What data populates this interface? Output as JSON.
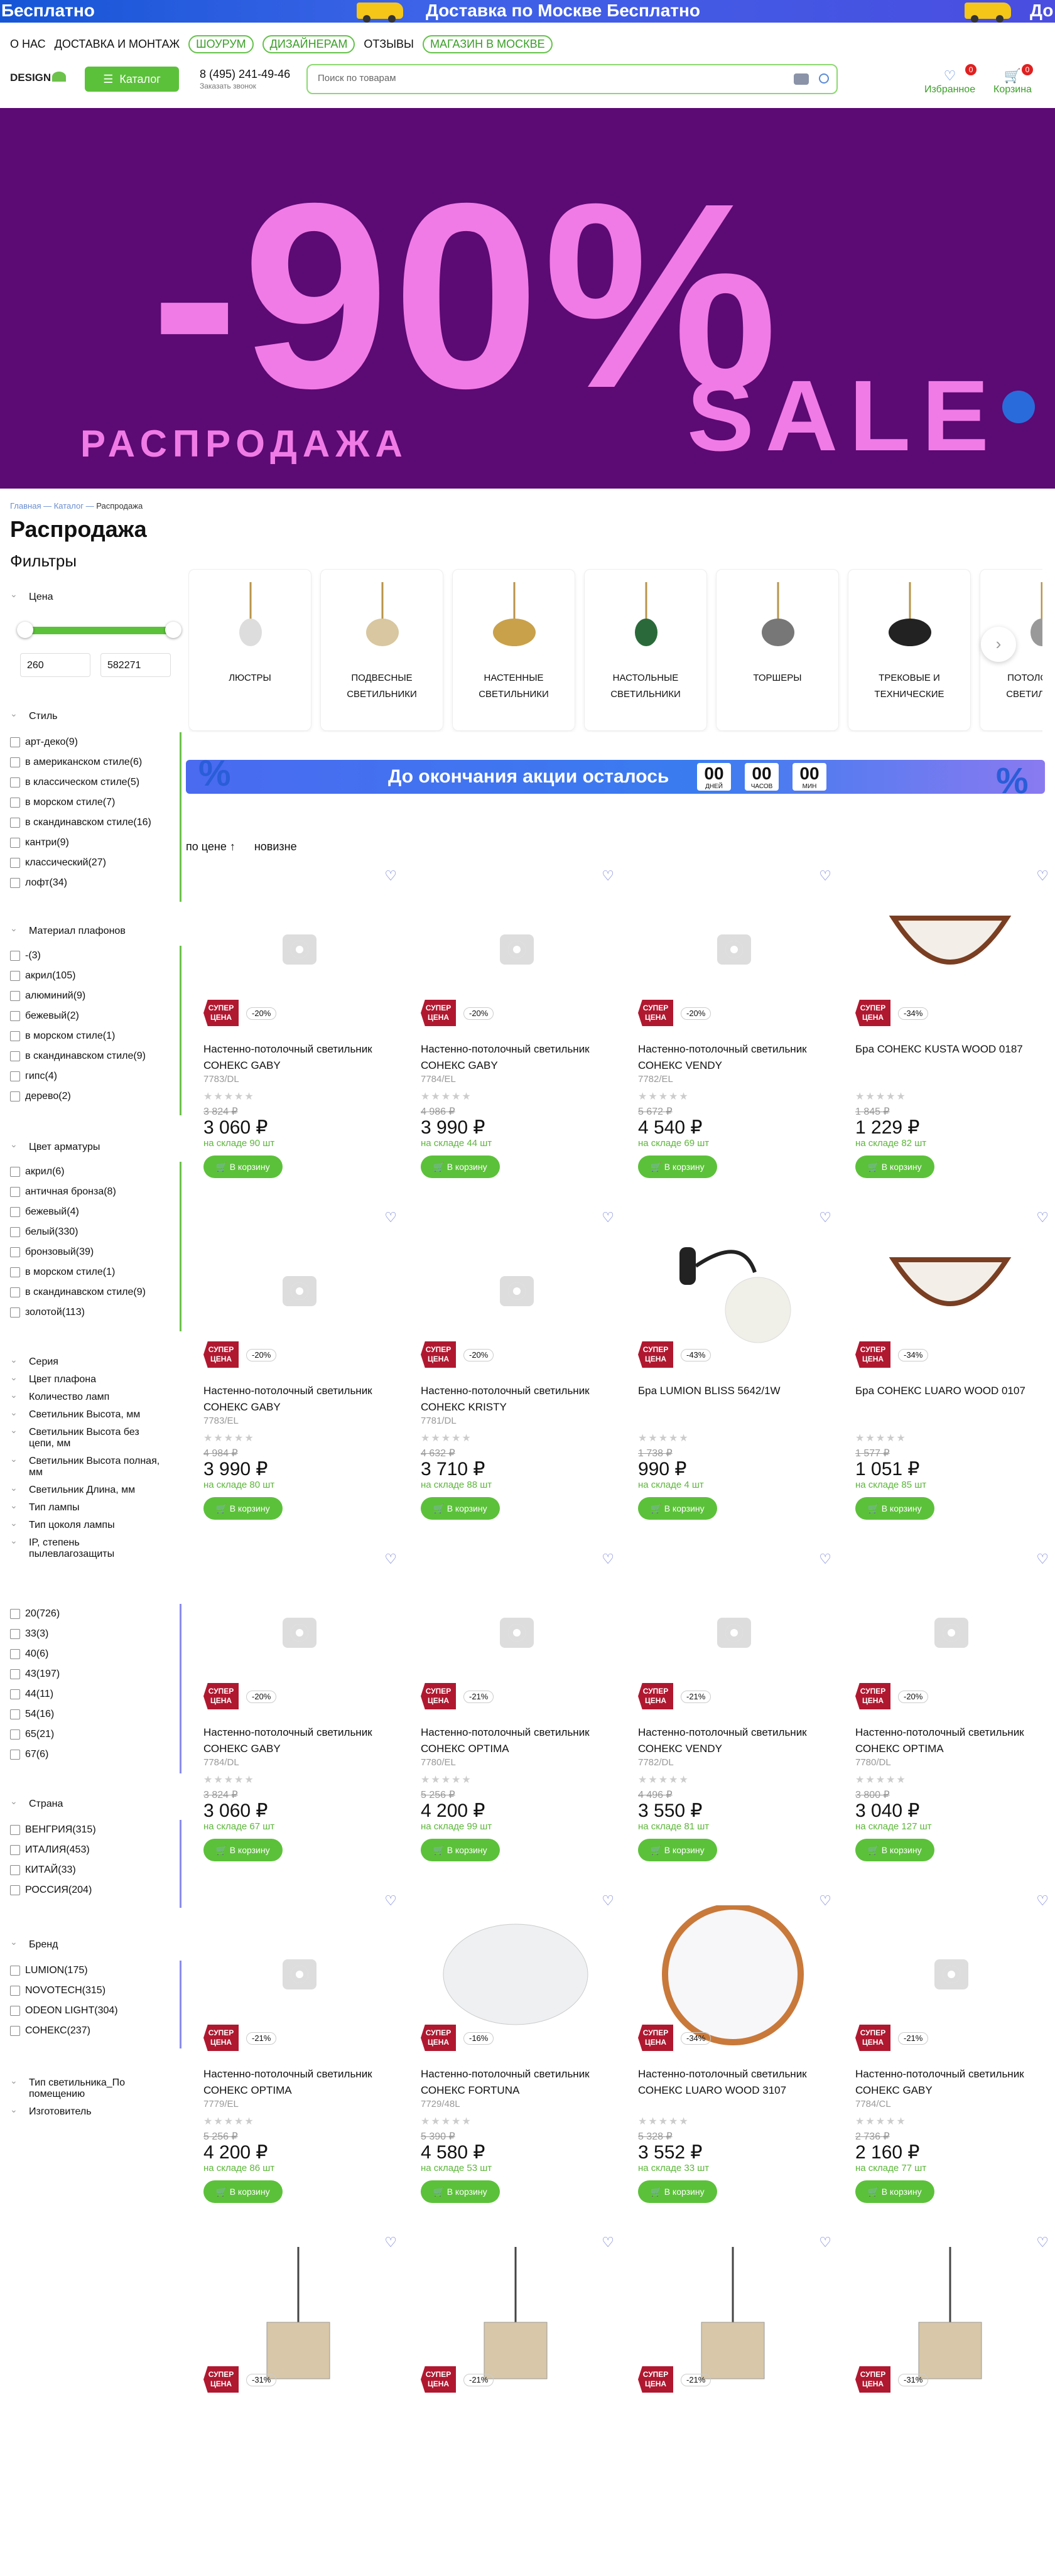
{
  "promo": {
    "left": "Бесплатно",
    "center": "Доставка по Москве Бесплатно",
    "right": "До"
  },
  "header": {
    "nav": [
      "О НАС",
      "ДОСТАВКА И МОНТАЖ"
    ],
    "pills": [
      "ШОУРУМ",
      "ДИЗАЙНЕРАМ"
    ],
    "nav2": "ОТЗЫВЫ",
    "pill3": "МАГАЗИН В МОСКВЕ",
    "logo": "DESIGN",
    "catalog": "Каталог",
    "phone": "8 (495) 241-49-46",
    "callback": "Заказать звонок",
    "search_placeholder": "Поиск по товарам",
    "fav": "Избранное",
    "cart": "Корзина",
    "fav_count": "0",
    "cart_count": "0"
  },
  "banner": {
    "big": "-90%",
    "sale": "SALE",
    "sub": "РАСПРОДАЖА"
  },
  "breadcrumb": [
    "Главная",
    "—",
    "Каталог",
    "—",
    "Распродажа"
  ],
  "page_title": "Распродажа",
  "filters_title": "Фильтры",
  "price_filter": {
    "title": "Цена",
    "min": "260",
    "max": "582271"
  },
  "style": {
    "title": "Стиль",
    "items": [
      "арт-деко(9)",
      "в американском стиле(6)",
      "в классическом стиле(5)",
      "в морском стиле(7)",
      "в скандинавском стиле(16)",
      "кантри(9)",
      "классический(27)",
      "лофт(34)"
    ]
  },
  "material": {
    "title": "Материал плафонов",
    "items": [
      "-(3)",
      "акрил(105)",
      "алюминий(9)",
      "бежевый(2)",
      "в морском стиле(1)",
      "в скандинавском стиле(9)",
      "гипс(4)",
      "дерево(2)"
    ]
  },
  "armature": {
    "title": "Цвет арматуры",
    "items": [
      "акрил(6)",
      "античная бронза(8)",
      "бежевый(4)",
      "белый(330)",
      "бронзовый(39)",
      "в морском стиле(1)",
      "в скандинавском стиле(9)",
      "золотой(113)"
    ]
  },
  "collapsed1": [
    "Серия",
    "Цвет плафона",
    "Количество ламп",
    "Светильник Высота, мм",
    "Светильник Высота без цепи, мм",
    "Светильник Высота полная, мм",
    "Светильник Длина, мм",
    "Тип лампы",
    "Тип цоколя лампы",
    "IP, степень пылевлагозащиты"
  ],
  "ip": {
    "items": [
      "20(726)",
      "33(3)",
      "40(6)",
      "43(197)",
      "44(11)",
      "54(16)",
      "65(21)",
      "67(6)"
    ]
  },
  "country": {
    "title": "Страна",
    "items": [
      "ВЕНГРИЯ(315)",
      "ИТАЛИЯ(453)",
      "КИТАЙ(33)",
      "РОССИЯ(204)"
    ]
  },
  "brand": {
    "title": "Бренд",
    "items": [
      "LUMION(175)",
      "NOVOTECH(315)",
      "ODEON LIGHT(304)",
      "СОНЕКС(237)"
    ]
  },
  "collapsed2": [
    "Тип светильника_По помещению",
    "Изготовитель"
  ],
  "categories": [
    "ЛЮСТРЫ",
    "ПОДВЕСНЫЕ СВЕТИЛЬНИКИ",
    "НАСТЕННЫЕ СВЕТИЛЬНИКИ",
    "НАСТОЛЬНЫЕ СВЕТИЛЬНИКИ",
    "ТОРШЕРЫ",
    "ТРЕКОВЫЕ И ТЕХНИЧЕСКИЕ",
    "ПОТОЛОЧНЫЕ СВЕТИЛЬНИКИ"
  ],
  "timer": {
    "text": "До окончания акции осталось",
    "days": "00",
    "hours": "00",
    "mins": "00",
    "days_l": "ДНЕЙ",
    "hours_l": "ЧАСОВ",
    "mins_l": "МИН",
    "pct": "%"
  },
  "sort": {
    "price": "по цене ↑",
    "new": "новизне"
  },
  "buy_label": "В корзину",
  "super_label": "СУПЕР ЦЕНА",
  "stars": "★★★★★",
  "products": [
    {
      "name": "Настенно-потолочный светильник СОНЕКС GABY",
      "art": "7783/DL",
      "old": "3 824 ₽",
      "price": "3 060 ₽",
      "stock": "на складе 90 шт",
      "disc": "-20%"
    },
    {
      "name": "Настенно-потолочный светильник СОНЕКС GABY",
      "art": "7784/EL",
      "old": "4 986 ₽",
      "price": "3 990 ₽",
      "stock": "на складе 44 шт",
      "disc": "-20%"
    },
    {
      "name": "Настенно-потолочный светильник СОНЕКС VENDY",
      "art": "7782/EL",
      "old": "5 672 ₽",
      "price": "4 540 ₽",
      "stock": "на складе 69 шт",
      "disc": "-20%"
    },
    {
      "name": "Бра СОНЕКС KUSTA WOOD 0187",
      "art": "",
      "old": "1 845 ₽",
      "price": "1 229 ₽",
      "stock": "на складе 82 шт",
      "disc": "-34%"
    },
    {
      "name": "Настенно-потолочный светильник СОНЕКС GABY",
      "art": "7783/EL",
      "old": "4 984 ₽",
      "price": "3 990 ₽",
      "stock": "на складе 80 шт",
      "disc": "-20%"
    },
    {
      "name": "Настенно-потолочный светильник СОНЕКС KRISTY",
      "art": "7781/DL",
      "old": "4 632 ₽",
      "price": "3 710 ₽",
      "stock": "на складе 88 шт",
      "disc": "-20%"
    },
    {
      "name": "Бра LUMION BLISS 5642/1W",
      "art": "",
      "old": "1 738 ₽",
      "price": "990 ₽",
      "stock": "на складе 4 шт",
      "disc": "-43%"
    },
    {
      "name": "Бра СОНЕКС LUARO WOOD 0107",
      "art": "",
      "old": "1 577 ₽",
      "price": "1 051 ₽",
      "stock": "на складе 85 шт",
      "disc": "-34%"
    },
    {
      "name": "Настенно-потолочный светильник СОНЕКС GABY",
      "art": "7784/DL",
      "old": "3 824 ₽",
      "price": "3 060 ₽",
      "stock": "на складе 67 шт",
      "disc": "-20%"
    },
    {
      "name": "Настенно-потолочный светильник СОНЕКС OPTIMA",
      "art": "7780/EL",
      "old": "5 256 ₽",
      "price": "4 200 ₽",
      "stock": "на складе 99 шт",
      "disc": "-21%"
    },
    {
      "name": "Настенно-потолочный светильник СОНЕКС VENDY",
      "art": "7782/DL",
      "old": "4 496 ₽",
      "price": "3 550 ₽",
      "stock": "на складе 81 шт",
      "disc": "-21%"
    },
    {
      "name": "Настенно-потолочный светильник СОНЕКС OPTIMA",
      "art": "7780/DL",
      "old": "3 800 ₽",
      "price": "3 040 ₽",
      "stock": "на складе 127 шт",
      "disc": "-20%"
    },
    {
      "name": "Настенно-потолочный светильник СОНЕКС OPTIMA",
      "art": "7779/EL",
      "old": "5 256 ₽",
      "price": "4 200 ₽",
      "stock": "на складе 86 шт",
      "disc": "-21%"
    },
    {
      "name": "Настенно-потолочный светильник СОНЕКС FORTUNA",
      "art": "7729/48L",
      "old": "5 390 ₽",
      "price": "4 580 ₽",
      "stock": "на складе 53 шт",
      "disc": "-16%"
    },
    {
      "name": "Настенно-потолочный светильник СОНЕКС LUARO WOOD 3107",
      "art": "",
      "old": "5 328 ₽",
      "price": "3 552 ₽",
      "stock": "на складе 33 шт",
      "disc": "-34%"
    },
    {
      "name": "Настенно-потолочный светильник СОНЕКС GABY",
      "art": "7784/CL",
      "old": "2 736 ₽",
      "price": "2 160 ₽",
      "stock": "на складе 77 шт",
      "disc": "-21%"
    },
    {
      "name": "",
      "art": "",
      "old": "",
      "price": "",
      "stock": "",
      "disc": "-31%"
    },
    {
      "name": "",
      "art": "",
      "old": "",
      "price": "",
      "stock": "",
      "disc": "-21%"
    },
    {
      "name": "",
      "art": "",
      "old": "",
      "price": "",
      "stock": "",
      "disc": "-21%"
    },
    {
      "name": "",
      "art": "",
      "old": "",
      "price": "",
      "stock": "",
      "disc": "-31%"
    }
  ]
}
